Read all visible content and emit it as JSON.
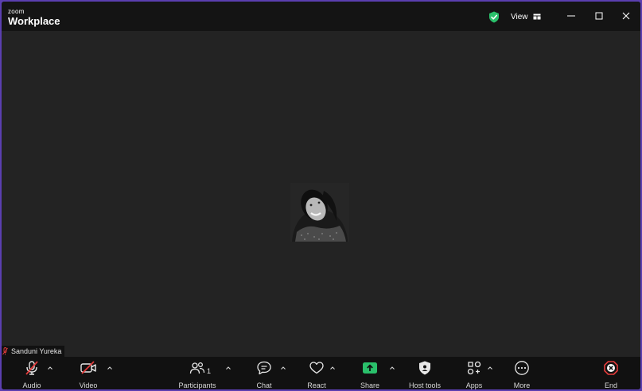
{
  "app": {
    "brand_top": "zoom",
    "brand_main": "Workplace"
  },
  "titlebar": {
    "view_label": "View",
    "icons": [
      "shield-check-icon",
      "view-grid-icon",
      "minimize-icon",
      "maximize-icon",
      "close-icon"
    ]
  },
  "participant": {
    "name": "Sanduni Yureka",
    "muted": true
  },
  "toolbar": {
    "audio_label": "Audio",
    "video_label": "Video",
    "participants_label": "Participants",
    "participants_count": "1",
    "chat_label": "Chat",
    "react_label": "React",
    "share_label": "Share",
    "host_tools_label": "Host tools",
    "apps_label": "Apps",
    "more_label": "More",
    "end_label": "End"
  },
  "colors": {
    "accent": "#2ac06b",
    "danger": "#e23b3b",
    "background": "#232323",
    "toolbar": "#111111"
  }
}
